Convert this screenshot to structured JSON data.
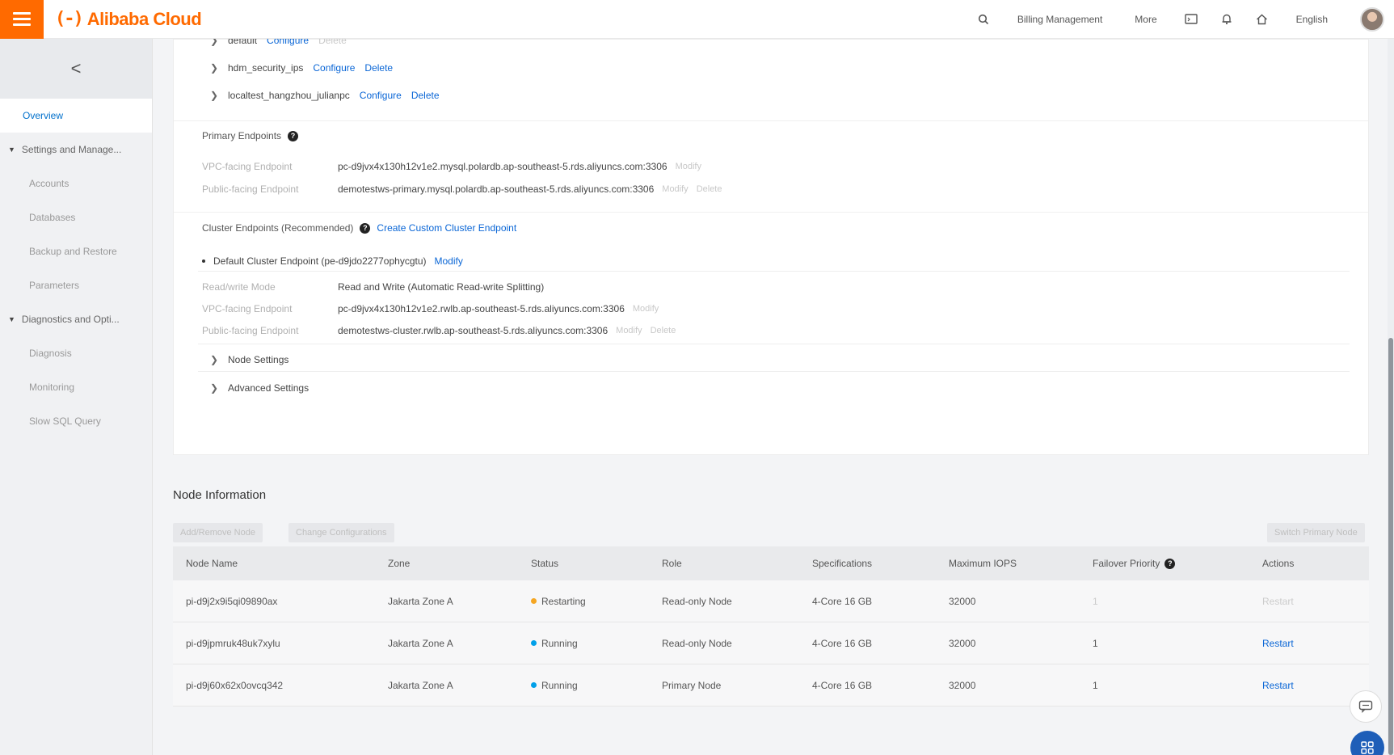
{
  "header": {
    "brand": "Alibaba Cloud",
    "brand_mark": "(-)",
    "nav": [
      "Billing Management",
      "More"
    ],
    "language": "English"
  },
  "sidebar": {
    "back": "<",
    "items": [
      {
        "type": "item",
        "label": "Overview",
        "active": true
      },
      {
        "type": "group",
        "label": "Settings and Manage..."
      },
      {
        "type": "item",
        "label": "Accounts"
      },
      {
        "type": "item",
        "label": "Databases"
      },
      {
        "type": "item",
        "label": "Backup and Restore"
      },
      {
        "type": "item",
        "label": "Parameters"
      },
      {
        "type": "group",
        "label": "Diagnostics and Opti..."
      },
      {
        "type": "item",
        "label": "Diagnosis"
      },
      {
        "type": "item",
        "label": "Monitoring"
      },
      {
        "type": "item",
        "label": "Slow SQL Query"
      }
    ]
  },
  "whitelists": [
    {
      "name": "default",
      "configure": "Configure",
      "delete": "Delete",
      "delete_disabled": true
    },
    {
      "name": "hdm_security_ips",
      "configure": "Configure",
      "delete": "Delete",
      "delete_disabled": false
    },
    {
      "name": "localtest_hangzhou_julianpc",
      "configure": "Configure",
      "delete": "Delete",
      "delete_disabled": false
    }
  ],
  "primary_endpoints": {
    "title": "Primary Endpoints",
    "vpc_label": "VPC-facing Endpoint",
    "vpc_value": "pc-d9jvx4x130h12v1e2.mysql.polardb.ap-southeast-5.rds.aliyuncs.com:3306",
    "vpc_modify": "Modify",
    "public_label": "Public-facing Endpoint",
    "public_value": "demotestws-primary.mysql.polardb.ap-southeast-5.rds.aliyuncs.com:3306",
    "public_modify": "Modify",
    "public_delete": "Delete"
  },
  "cluster_endpoints": {
    "title": "Cluster Endpoints (Recommended)",
    "create_link": "Create Custom Cluster Endpoint",
    "default_name": "Default Cluster Endpoint (pe-d9jdo2277ophycgtu)",
    "default_modify": "Modify",
    "rw_label": "Read/write Mode",
    "rw_value": "Read and Write (Automatic Read-write Splitting)",
    "vpc_label": "VPC-facing Endpoint",
    "vpc_value": "pc-d9jvx4x130h12v1e2.rwlb.ap-southeast-5.rds.aliyuncs.com:3306",
    "vpc_modify": "Modify",
    "public_label": "Public-facing Endpoint",
    "public_value": "demotestws-cluster.rwlb.ap-southeast-5.rds.aliyuncs.com:3306",
    "public_modify": "Modify",
    "public_delete": "Delete",
    "node_settings": "Node Settings",
    "advanced_settings": "Advanced Settings"
  },
  "node_info": {
    "title": "Node Information",
    "add_remove": "Add/Remove Node",
    "change_config": "Change Configurations",
    "switch_primary": "Switch Primary Node",
    "columns": [
      "Node Name",
      "Zone",
      "Status",
      "Role",
      "Specifications",
      "Maximum IOPS",
      "Failover Priority",
      "Actions"
    ],
    "rows": [
      {
        "name": "pi-d9j2x9i5qi09890ax",
        "zone": "Jakarta Zone A",
        "status": "Restarting",
        "status_color": "#f5a623",
        "role": "Read-only Node",
        "spec": "4-Core 16 GB",
        "iops": "32000",
        "priority": "1",
        "action": "Restart",
        "action_disabled": true
      },
      {
        "name": "pi-d9jpmruk48uk7xylu",
        "zone": "Jakarta Zone A",
        "status": "Running",
        "status_color": "#00a0e9",
        "role": "Read-only Node",
        "spec": "4-Core 16 GB",
        "iops": "32000",
        "priority": "1",
        "action": "Restart",
        "action_disabled": false
      },
      {
        "name": "pi-d9j60x62x0ovcq342",
        "zone": "Jakarta Zone A",
        "status": "Running",
        "status_color": "#00a0e9",
        "role": "Primary Node",
        "spec": "4-Core 16 GB",
        "iops": "32000",
        "priority": "1",
        "action": "Restart",
        "action_disabled": false
      }
    ]
  },
  "colors": {
    "brand": "#ff6a00",
    "link": "#0a66d6"
  }
}
